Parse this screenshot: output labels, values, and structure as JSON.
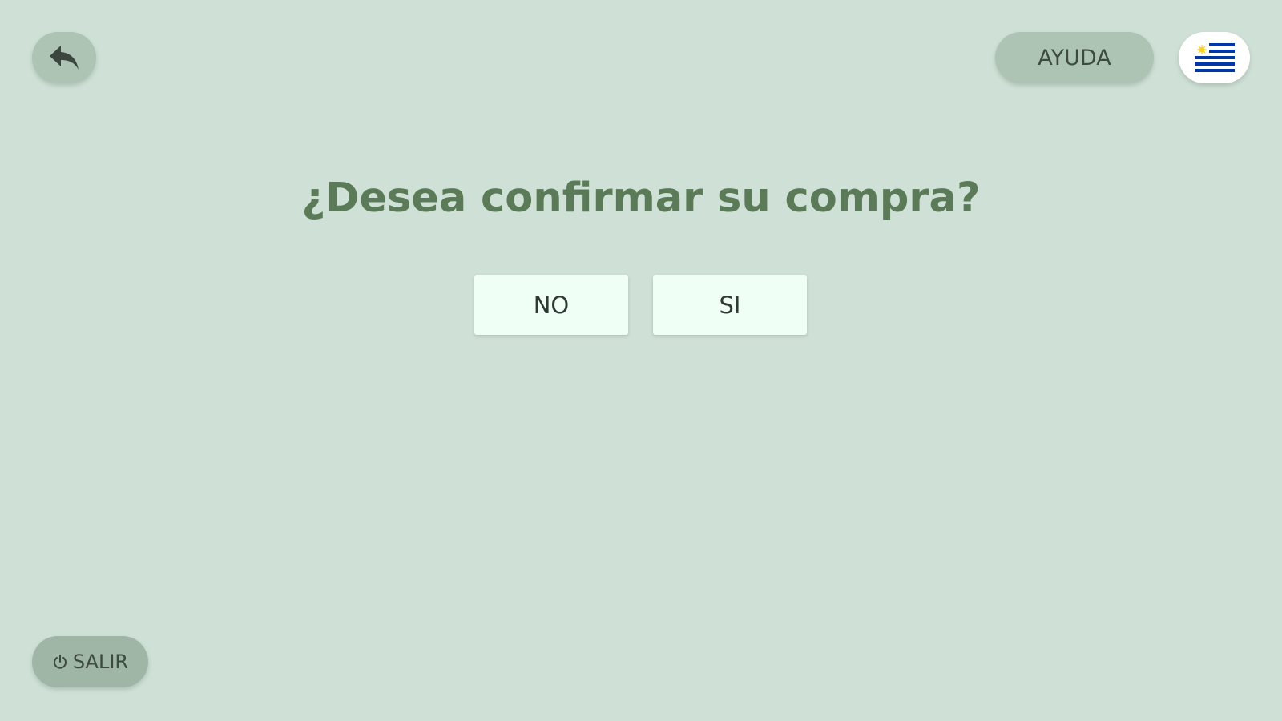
{
  "header": {
    "back_icon": "reply-arrow-icon",
    "help_label": "AYUDA",
    "language_flag": "uruguay-flag-icon"
  },
  "dialog": {
    "question": "¿Desea confirmar su compra?",
    "no_label": "NO",
    "yes_label": "SI"
  },
  "footer": {
    "exit_icon": "power-icon",
    "exit_label": "SALIR"
  },
  "colors": {
    "background": "#cfe1d6",
    "title": "#5b7b58",
    "pill_button": "#adc4b5",
    "choice_button": "#effff5",
    "flag_blue": "#0038a8",
    "flag_sun": "#fcd116"
  }
}
